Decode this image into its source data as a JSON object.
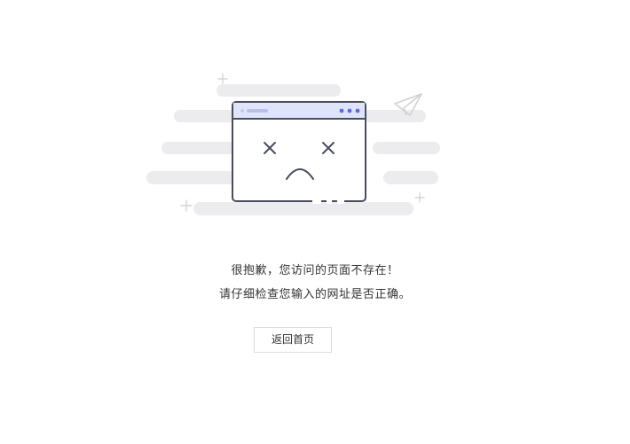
{
  "error": {
    "line1": "很抱歉，您访问的页面不存在！",
    "line2": "请仔细检查您输入的网址是否正确。"
  },
  "actions": {
    "home_label": "返回首页"
  },
  "colors": {
    "cloud": "#ececee",
    "window_stroke": "#4a4d5c",
    "window_header": "#dfe4fb",
    "accent_dots": "#5c6ed6",
    "sparkle": "#d4d4d8",
    "text": "#333333",
    "button_border": "#dcdcdc"
  },
  "icons": {
    "illustration": "broken-browser-window-icon",
    "paper_plane": "paper-plane-icon",
    "sparkle": "sparkle-icon"
  }
}
